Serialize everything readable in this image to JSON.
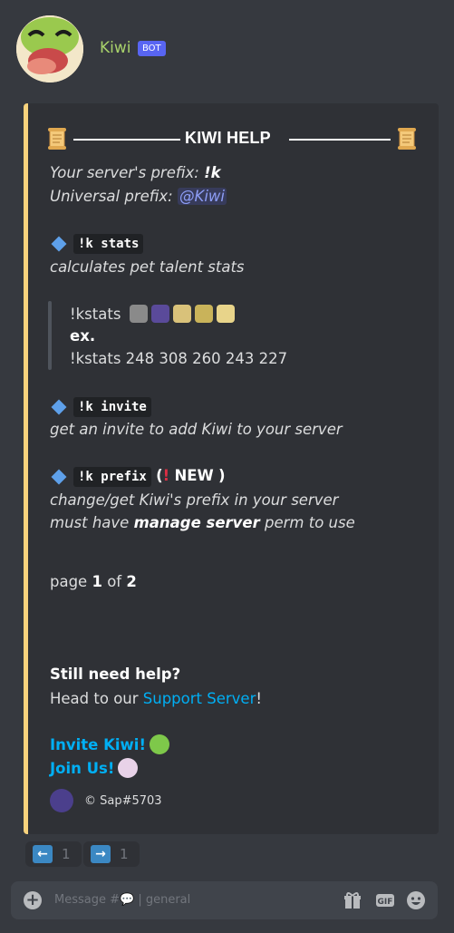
{
  "header": {
    "username": "Kiwi",
    "badge": "BOT"
  },
  "embed": {
    "title": "KIWI HELP",
    "prefix_label": "Your server's prefix: ",
    "prefix_value": "!k",
    "universal_label": "Universal prefix: ",
    "universal_mention": "@Kiwi",
    "commands": [
      {
        "code": "!k stats",
        "desc": "calculates pet talent stats"
      },
      {
        "code": "!k invite",
        "desc": "get an invite to add Kiwi to your server"
      },
      {
        "code": "!k prefix",
        "paren_open": "(",
        "new_label": "NEW",
        "paren_close": ")",
        "desc_line1": "change/get Kiwi's prefix in your server",
        "desc_line2_pre": "must have ",
        "desc_line2_bold": "manage server",
        "desc_line2_post": " perm to use"
      }
    ],
    "quote": {
      "line1": "!kstats",
      "line2": "ex.",
      "line3": "!kstats 248 308 260 243 227"
    },
    "page": {
      "pre": "page ",
      "current": "1",
      "mid": " of ",
      "total": "2"
    },
    "help": {
      "heading": "Still need help?",
      "pre": "Head to our ",
      "link": "Support Server",
      "post": "!"
    },
    "invite_link": "Invite Kiwi!",
    "join_link": "Join Us!",
    "footer": "© Sap#5703"
  },
  "reactions": [
    {
      "icon": "arrow-left-icon",
      "count": "1"
    },
    {
      "icon": "arrow-right-icon",
      "count": "1"
    }
  ],
  "input": {
    "placeholder": "Message #💬 | general"
  }
}
